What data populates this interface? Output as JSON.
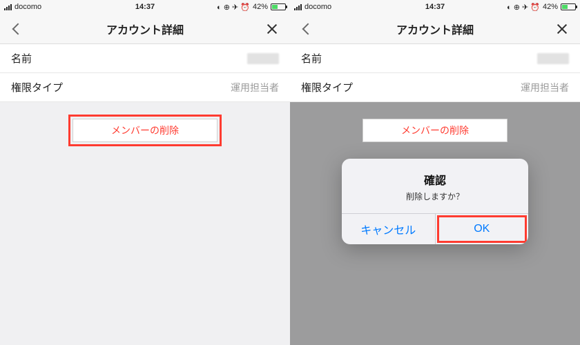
{
  "status": {
    "carrier": "docomo",
    "time": "14:37",
    "battery_pct": "42%",
    "indicators": "◐ ⊕ ✈ ⏰"
  },
  "nav": {
    "title": "アカウント詳細"
  },
  "rows": {
    "name_label": "名前",
    "name_value": "",
    "role_label": "権限タイプ",
    "role_value": "運用担当者"
  },
  "delete_label": "メンバーの削除",
  "dialog": {
    "title": "確認",
    "message": "削除しますか？",
    "cancel": "キャンセル",
    "ok": "OK"
  }
}
